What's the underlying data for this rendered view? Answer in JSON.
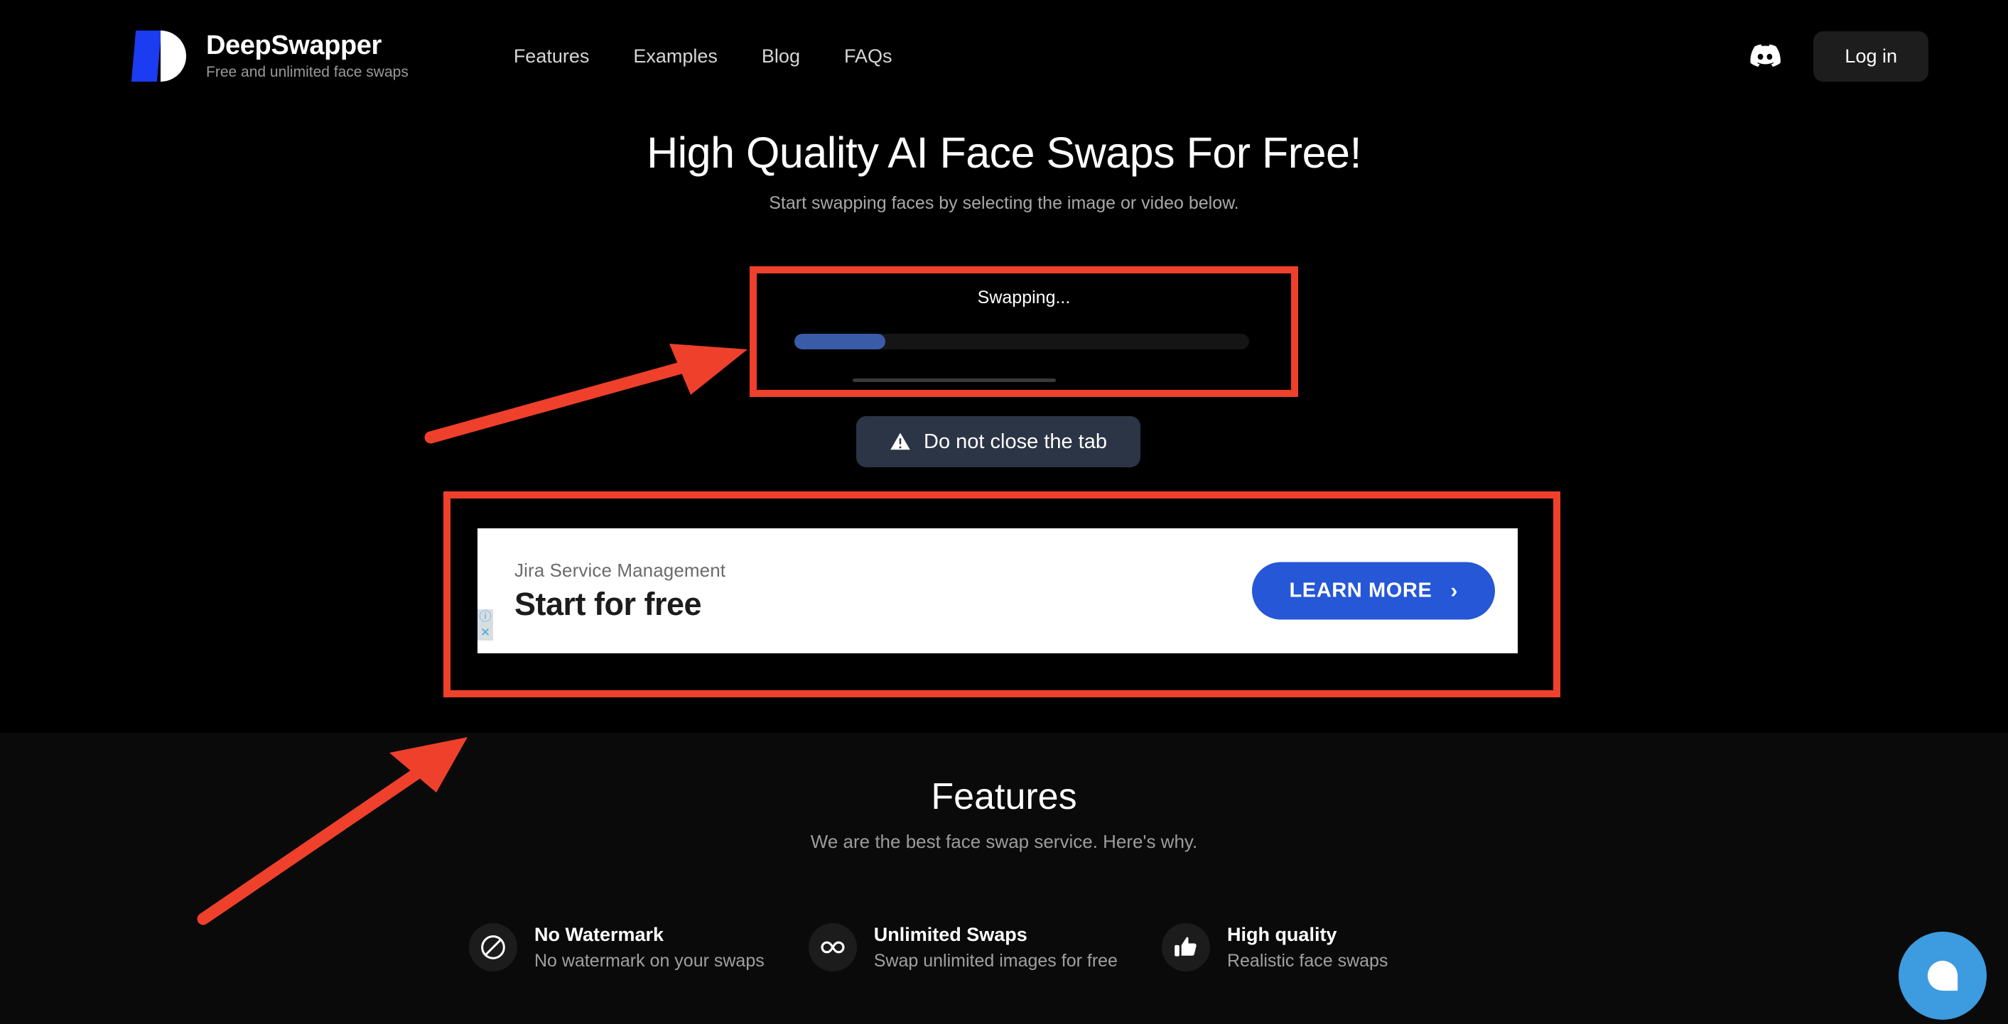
{
  "brand": {
    "name": "DeepSwapper",
    "tagline": "Free and unlimited face swaps",
    "logo_icon": "deepswapper-logo-icon"
  },
  "nav": {
    "items": [
      {
        "label": "Features"
      },
      {
        "label": "Examples"
      },
      {
        "label": "Blog"
      },
      {
        "label": "FAQs"
      }
    ]
  },
  "header": {
    "discord_icon": "discord-icon",
    "login_label": "Log in"
  },
  "hero": {
    "title": "High Quality AI Face Swaps For Free!",
    "subtitle": "Start swapping faces by selecting the image or video below."
  },
  "swap": {
    "status_label": "Swapping...",
    "progress_percent": 20,
    "progress_fill_color": "#3a5ca8",
    "progress_track_color": "#151515"
  },
  "warning": {
    "icon": "warning-triangle-icon",
    "label": "Do not close the tab",
    "background_color": "#2b3545"
  },
  "ad": {
    "eyebrow": "Jira Service Management",
    "headline": "Start for free",
    "cta_label": "LEARN MORE",
    "cta_chevron": "›",
    "cta_color": "#2557d6",
    "adchoices_info_icon": "ⓘ",
    "adchoices_close_icon": "✕"
  },
  "features": {
    "title": "Features",
    "subtitle": "We are the best face swap service. Here's why.",
    "items": [
      {
        "icon": "no-watermark-prohibited-icon",
        "title": "No Watermark",
        "desc": "No watermark on your swaps"
      },
      {
        "icon": "infinity-icon",
        "title": "Unlimited Swaps",
        "desc": "Swap unlimited images for free"
      },
      {
        "icon": "thumbs-up-icon",
        "title": "High quality",
        "desc": "Realistic face swaps"
      }
    ]
  },
  "chat_widget": {
    "icon": "chat-bubble-icon",
    "color": "#3d9be0"
  },
  "annotations": {
    "highlight_color": "#ef402c",
    "boxes": [
      {
        "target": "swap-progress-panel"
      },
      {
        "target": "ad-banner"
      }
    ],
    "arrows": [
      {
        "target": "swap-progress-panel",
        "direction": "up-right"
      },
      {
        "target": "ad-banner",
        "direction": "up-right"
      }
    ]
  }
}
